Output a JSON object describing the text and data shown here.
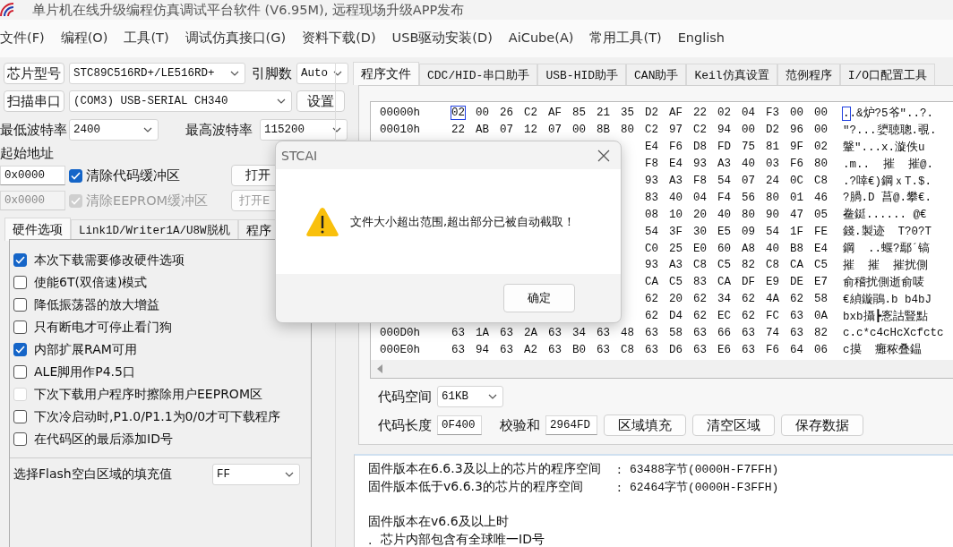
{
  "window": {
    "title": "单片机在线升级编程仿真调试平台软件 (V6.95M), 远程现场升级APP发布"
  },
  "menu": [
    "文件(F)",
    "编程(O)",
    "工具(T)",
    "调试仿真接口(G)",
    "资料下载(D)",
    "USB驱动安装(D)",
    "AiCube(A)",
    "常用工具(T)",
    "English"
  ],
  "left": {
    "chip_button": "芯片型号",
    "chip_select": "STC89C516RD+/LE516RD+",
    "pins_label": "引脚数",
    "pins_select": "Auto",
    "scan_button": "扫描串口",
    "port_select": "(COM3) USB-SERIAL CH340",
    "settings_button": "设置",
    "min_baud_label": "最低波特率",
    "min_baud_select": "2400",
    "max_baud_label": "最高波特率",
    "max_baud_select": "115200",
    "start_address_label": "起始地址",
    "buffers": [
      {
        "address": "0x0000",
        "label": "清除代码缓冲区",
        "checked": true,
        "disabled": false,
        "open_button": "打开"
      },
      {
        "address": "0x0000",
        "label": "清除EEPROM缓冲区",
        "checked": true,
        "disabled": true,
        "open_button": "打开E"
      }
    ],
    "tabs": [
      {
        "label": "硬件选项",
        "selected": true
      },
      {
        "label": "Link1D/Writer1A/U8W脱机",
        "selected": false
      },
      {
        "label": "程序",
        "selected": false
      }
    ],
    "options": [
      {
        "label": "本次下载需要修改硬件选项",
        "checked": true,
        "disabled": false
      },
      {
        "label": "使能6T(双倍速)模式",
        "checked": false,
        "disabled": false
      },
      {
        "label": "降低振荡器的放大增益",
        "checked": false,
        "disabled": false
      },
      {
        "label": "只有断电才可停止看门狗",
        "checked": false,
        "disabled": false
      },
      {
        "label": "内部扩展RAM可用",
        "checked": true,
        "disabled": false
      },
      {
        "label": "ALE脚用作P4.5口",
        "checked": false,
        "disabled": false
      },
      {
        "label": "下次下载用户程序时擦除用户EEPROM区",
        "checked": false,
        "disabled": true
      },
      {
        "label": "下次冷启动时,P1.0/P1.1为0/0才可下载程序",
        "checked": false,
        "disabled": false
      },
      {
        "label": "在代码区的最后添加ID号",
        "checked": false,
        "disabled": false
      }
    ],
    "fill_label": "选择Flash空白区域的填充值",
    "fill_select": "FF"
  },
  "right": {
    "tabs": [
      {
        "label": "程序文件",
        "selected": true
      },
      {
        "label": "CDC/HID-串口助手",
        "selected": false
      },
      {
        "label": "USB-HID助手",
        "selected": false
      },
      {
        "label": "CAN助手",
        "selected": false
      },
      {
        "label": "Keil仿真设置",
        "selected": false
      },
      {
        "label": "范例程序",
        "selected": false
      },
      {
        "label": "I/O口配置工具",
        "selected": false
      }
    ],
    "hex_rows": [
      {
        "address": "00000h",
        "bytes": [
          "02",
          "00",
          "26",
          "C2",
          "AF",
          "85",
          "21",
          "35",
          "D2",
          "AF",
          "22",
          "02",
          "04",
          "F3",
          "00",
          "00"
        ],
        "ascii": "..&炉?5爷\"..?.",
        "selected": true
      },
      {
        "address": "00010h",
        "bytes": [
          "22",
          "AB",
          "07",
          "12",
          "07",
          "00",
          "8B",
          "80",
          "C2",
          "97",
          "C2",
          "94",
          "00",
          "D2",
          "96",
          "00"
        ],
        "ascii": "\"?...嬃聴聰.覗.",
        "selected": false
      },
      {
        "bytes": [
          "E4",
          "F6",
          "D8",
          "FD",
          "75",
          "81",
          "9F",
          "02"
        ],
        "ascii": "鞶\"...x.漩佚u",
        "selected": false
      },
      {
        "bytes": [
          "F8",
          "E4",
          "93",
          "A3",
          "40",
          "03",
          "F6",
          "80"
        ],
        "ascii": ".m..  摧  摧@.",
        "selected": false
      },
      {
        "bytes": [
          "93",
          "A3",
          "F8",
          "54",
          "07",
          "24",
          "0C",
          "C8"
        ],
        "ascii": ".?啈€)鋼ｘT.$.",
        "selected": false
      },
      {
        "bytes": [
          "83",
          "40",
          "04",
          "F4",
          "56",
          "80",
          "01",
          "46"
        ],
        "ascii": "?腡.D 菖@.攀€.",
        "selected": false
      },
      {
        "bytes": [
          "08",
          "10",
          "20",
          "40",
          "80",
          "90",
          "47",
          "05"
        ],
        "ascii": "鲞鋌...... @€",
        "selected": false
      },
      {
        "bytes": [
          "54",
          "3F",
          "30",
          "E5",
          "09",
          "54",
          "1F",
          "FE"
        ],
        "ascii": "錢.製迹  T?0?T",
        "selected": false
      },
      {
        "bytes": [
          "C0",
          "25",
          "E0",
          "60",
          "A8",
          "40",
          "B8",
          "E4"
        ],
        "ascii": "鋼  ..蝘?鄢´镐",
        "selected": false
      },
      {
        "bytes": [
          "93",
          "A3",
          "C8",
          "C5",
          "82",
          "C8",
          "CA",
          "C5"
        ],
        "ascii": "摧  摧  摧扰側",
        "selected": false
      },
      {
        "bytes": [
          "CA",
          "C5",
          "83",
          "CA",
          "DF",
          "E9",
          "DE",
          "E7"
        ],
        "ascii": "俞稽扰側逝俞唛",
        "selected": false
      },
      {
        "bytes": [
          "62",
          "20",
          "62",
          "34",
          "62",
          "4A",
          "62",
          "58"
        ],
        "ascii": "€緽鏇鵑.b b4bJ",
        "selected": false
      },
      {
        "bytes": [
          "62",
          "D4",
          "62",
          "EC",
          "62",
          "FC",
          "63",
          "0A"
        ],
        "ascii": "bxb攝┣愙詁豎點",
        "selected": false
      },
      {
        "address": "000D0h",
        "bytes": [
          "63",
          "1A",
          "63",
          "2A",
          "63",
          "34",
          "63",
          "48",
          "63",
          "58",
          "63",
          "66",
          "63",
          "74",
          "63",
          "82"
        ],
        "ascii": "c.c*c4cHcXcfctc",
        "selected": false
      },
      {
        "address": "000E0h",
        "bytes": [
          "63",
          "94",
          "63",
          "A2",
          "63",
          "B0",
          "63",
          "C8",
          "63",
          "D6",
          "63",
          "E6",
          "63",
          "F6",
          "64",
          "06"
        ],
        "ascii": "c摸  癱秾叠鎾",
        "selected": false
      }
    ],
    "code_space_label": "代码空间",
    "code_space_select": "61KB",
    "code_length_label": "代码长度",
    "code_length": "0F400",
    "checksum_label": "校验和",
    "checksum": "2964FD",
    "buttons": [
      "区域填充",
      "清空区域",
      "保存数据"
    ]
  },
  "log": [
    {
      "kind": "pair",
      "label": "固件版本在6.6.3及以上的芯片的程序空间",
      "separator": ":",
      "value": "63488字节(0000H-F7FFH)"
    },
    {
      "kind": "pair",
      "label": "固件版本低于v6.6.3的芯片的程序空间",
      "separator": ":",
      "value": "62464字节(0000H-F3FFH)"
    },
    {
      "kind": "blank"
    },
    {
      "kind": "text",
      "text": "固件版本在v6.6及以上时"
    },
    {
      "kind": "bullet",
      "marker": ".",
      "text": "芯片内部包含有全球唯一ID号"
    }
  ],
  "dialog": {
    "title": "STCAI",
    "message": "文件大小超出范围,超出部分已被自动截取！",
    "button": "确定"
  }
}
